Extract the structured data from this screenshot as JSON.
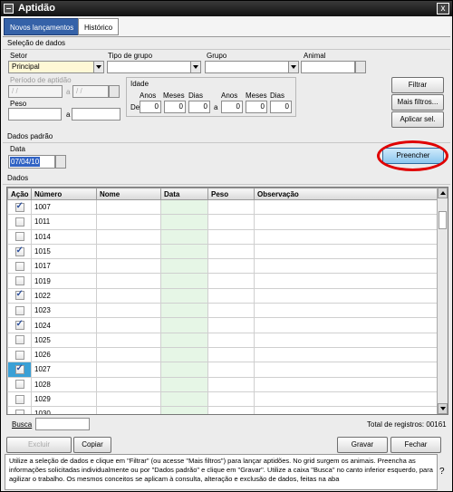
{
  "window": {
    "title": "Aptidão",
    "close_glyph": "x"
  },
  "tabs": [
    {
      "label": "Novos lançamentos",
      "active": true
    },
    {
      "label": "Histórico",
      "active": false
    }
  ],
  "selecao": {
    "heading": "Seleção de dados",
    "setor_label": "Setor",
    "setor_value": "Principal",
    "tipo_label": "Tipo de grupo",
    "grupo_label": "Grupo",
    "animal_label": "Animal",
    "periodo_label": "Período de aptidão",
    "periodo_from": " / /",
    "periodo_sep": "a",
    "periodo_to": " / /",
    "peso_label": "Peso",
    "peso_sep": "a",
    "idade_label": "Idade",
    "anos_label": "Anos",
    "meses_label": "Meses",
    "dias_label": "Dias",
    "de_label": "De",
    "a_label": "a",
    "idade_from": [
      "0",
      "0",
      "0"
    ],
    "idade_to": [
      "0",
      "0",
      "0"
    ],
    "filtrar_button": "Filtrar",
    "mais_filtros_button": "Mais filtros...",
    "aplicar_sel_button": "Aplicar sel."
  },
  "padrao": {
    "heading": "Dados padrão",
    "data_label": "Data",
    "data_value": "07/04/10",
    "preencher_button": "Preencher"
  },
  "dados": {
    "heading": "Dados",
    "columns": [
      "Ação",
      "Número",
      "Nome",
      "Data",
      "Peso",
      "Observação"
    ],
    "rows": [
      {
        "checked": true,
        "numero": "1007"
      },
      {
        "checked": false,
        "numero": "1011"
      },
      {
        "checked": false,
        "numero": "1014"
      },
      {
        "checked": true,
        "numero": "1015"
      },
      {
        "checked": false,
        "numero": "1017"
      },
      {
        "checked": false,
        "numero": "1019"
      },
      {
        "checked": true,
        "numero": "1022"
      },
      {
        "checked": false,
        "numero": "1023"
      },
      {
        "checked": true,
        "numero": "1024"
      },
      {
        "checked": false,
        "numero": "1025"
      },
      {
        "checked": false,
        "numero": "1026"
      },
      {
        "checked": true,
        "numero": "1027",
        "selected": true
      },
      {
        "checked": false,
        "numero": "1028"
      },
      {
        "checked": false,
        "numero": "1029"
      },
      {
        "checked": false,
        "numero": "1030"
      }
    ]
  },
  "footer": {
    "busca_label": "Busca",
    "total_label": "Total de registros: 00161",
    "excluir_button": "Excluir",
    "copiar_button": "Copiar",
    "gravar_button": "Gravar",
    "fechar_button": "Fechar",
    "help_text": "Utilize a seleção de dados e clique em \"Filtrar\" (ou acesse \"Mais filtros\") para lançar aptidões. No grid surgem os animais. Preencha as informações solicitadas individualmente ou por \"Dados padrão\" e clique em \"Gravar\". Utilize a caixa \"Busca\" no canto inferior esquerdo, para agilizar o trabalho. Os mesmos conceitos se aplicam à consulta, alteração e exclusão de dados, feitas na aba",
    "help_glyph": "?"
  },
  "colors": {
    "accent": "#3562a8",
    "date_column": "#e6f6e6",
    "highlight_ring": "#e00000"
  }
}
